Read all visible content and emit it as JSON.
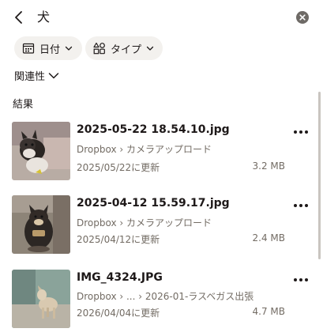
{
  "header": {
    "search_query": "犬",
    "back_icon": "chevron-left-icon",
    "clear_icon": "clear-circle-icon"
  },
  "filters": {
    "date_label": "日付",
    "type_label": "タイプ"
  },
  "sort": {
    "label": "関連性"
  },
  "results_heading": "結果",
  "results": [
    {
      "name": "2025-05-22 18.54.10.jpg",
      "path": "Dropbox › カメラアップロード",
      "updated": "2025/05/22に更新",
      "size": "3.2 MB"
    },
    {
      "name": "2025-04-12 15.59.17.jpg",
      "path": "Dropbox › カメラアップロード",
      "updated": "2025/04/12に更新",
      "size": "2.4 MB"
    },
    {
      "name": "IMG_4324.JPG",
      "path": "Dropbox › ... › 2026-01-ラスベガス出張",
      "updated": "2026/04/04に更新",
      "size": "4.7 MB"
    }
  ],
  "colors": {
    "text": "#1e1919",
    "secondary": "#736c64",
    "chip_bg": "#f3f1ee"
  }
}
